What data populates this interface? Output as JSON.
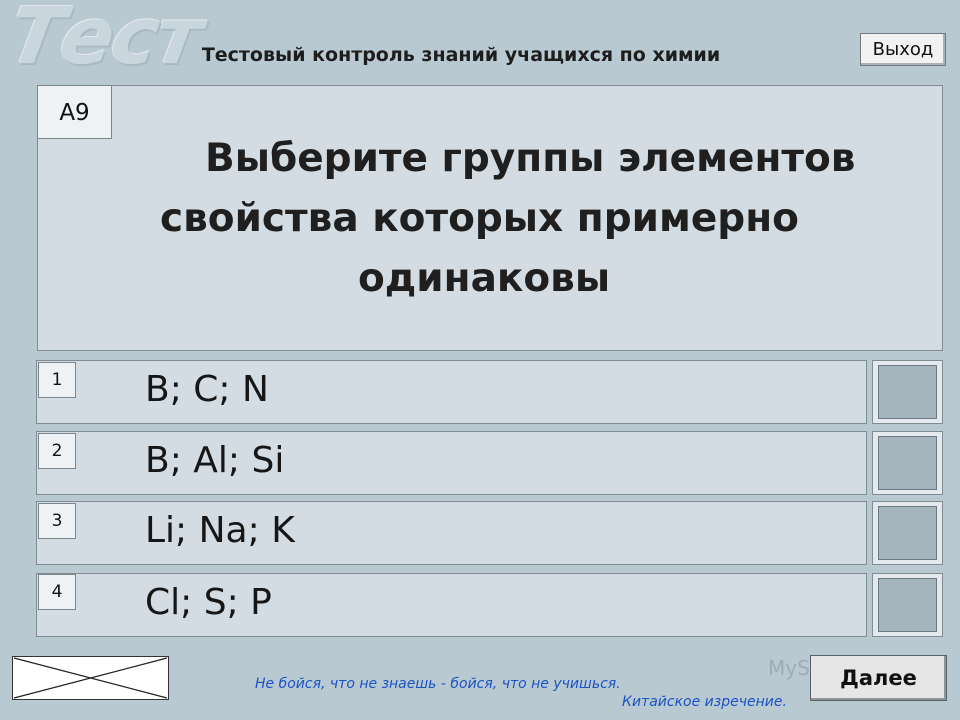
{
  "logo": {
    "text": "Тест"
  },
  "header": {
    "title": "Тестовый контроль знаний учащихся по химии"
  },
  "toolbar": {
    "exit_label": "Выход",
    "next_label": "Далее"
  },
  "question": {
    "number": "А9",
    "lines": [
      "Выберите группы элементов",
      "свойства которых примерно",
      "одинаковы"
    ]
  },
  "answers": [
    {
      "num": "1",
      "text": "B; C; N"
    },
    {
      "num": "2",
      "text": "B; Al; Si"
    },
    {
      "num": "3",
      "text": "Li; Na; K"
    },
    {
      "num": "4",
      "text": "Cl; S; P"
    }
  ],
  "footer": {
    "proverb": "Не бойся, что не знаешь - бойся, что не учишься.",
    "source": "Китайское изречение."
  },
  "watermark": {
    "text": "MyShared"
  }
}
